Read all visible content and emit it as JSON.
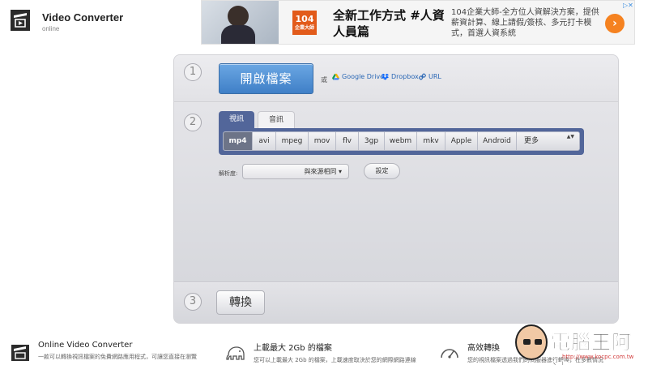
{
  "app": {
    "title": "Video Converter",
    "subtitle": "online",
    "logo_icon": "film-clapper-icon"
  },
  "ad": {
    "brand_num": "104",
    "brand_sub": "企業大師",
    "headline": "全新工作方式 #人資人員篇",
    "body": "104企業大師-全方位人資解決方案，提供薪資計算、線上請假/簽核、多元打卡模式，首選人資系統",
    "info_icon": "ad-choices-icon",
    "arrow": "›",
    "accent": "#f58220"
  },
  "step1": {
    "number": "1",
    "open_label": "開啟檔案",
    "or_label": "或",
    "sources": [
      {
        "label": "Google Drive",
        "icon": "google-drive-icon"
      },
      {
        "label": "Dropbox",
        "icon": "dropbox-icon"
      },
      {
        "label": "URL",
        "icon": "link-icon"
      }
    ]
  },
  "step2": {
    "number": "2",
    "tabs": [
      {
        "label": "視訊",
        "selected": true
      },
      {
        "label": "音訊",
        "selected": false
      }
    ],
    "formats": [
      "mp4",
      "avi",
      "mpeg",
      "mov",
      "flv",
      "3gp",
      "webm",
      "mkv",
      "Apple",
      "Android"
    ],
    "selected_format": "mp4",
    "more_label": "更多",
    "more_arrows": "▲▼",
    "resolution_label": "解析度:",
    "resolution_value": "與來源相同 ▾",
    "settings_label": "設定"
  },
  "step3": {
    "number": "3",
    "convert_label": "轉換"
  },
  "features": [
    {
      "title": "Online Video Converter",
      "text": "一款可以轉換視訊檔案的免費網路應用程式，可讓您直接在瀏覽",
      "icon": "video-file-icon"
    },
    {
      "title": "上載最大 2Gb 的檔案",
      "text": "您可以上載最大 2Gb 的檔案，上載速度取決於您的網際網路連線",
      "icon": "elephant-icon"
    },
    {
      "title": "高效轉換",
      "text": "您的視訊檔案透過我們的伺服器進行轉換，在多數情況",
      "icon": "speedometer-icon"
    }
  ],
  "watermark": {
    "text": "電腦王阿達",
    "url": "http://www.kocpc.com.tw"
  },
  "colors": {
    "primary_blue": "#3f7fc7",
    "tab_bar": "#52669a",
    "active_format": "#6d7488"
  }
}
